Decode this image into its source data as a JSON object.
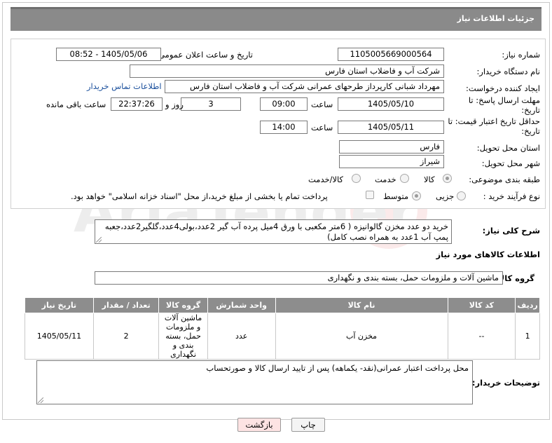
{
  "header": {
    "title": "جزئیات اطلاعات نیاز"
  },
  "form": {
    "need_number": {
      "label": "شماره نیاز:",
      "value": "1105005669000564"
    },
    "announce_datetime": {
      "label": "تاریخ و ساعت اعلان عمومی:",
      "value": "1405/05/06 - 08:52"
    },
    "buyer_org": {
      "label": "نام دستگاه خریدار:",
      "value": "شرکت آب و فاضلاب استان فارس"
    },
    "requester": {
      "label": "ایجاد کننده درخواست:",
      "value": "مهرداد شبانی کارپرداز طرحهای عمرانی  شرکت آب و فاضلاب استان فارس",
      "contact_link": "اطلاعات تماس خریدار"
    },
    "reply_deadline": {
      "label": "مهلت ارسال پاسخ: تا تاریخ:",
      "date": "1405/05/10",
      "time_label": "ساعت",
      "time": "09:00",
      "days": "3",
      "days_label": "روز و",
      "remaining": "22:37:26",
      "remaining_label": "ساعت باقی مانده"
    },
    "price_validity": {
      "label": "حداقل تاریخ اعتبار قیمت: تا تاریخ:",
      "date": "1405/05/11",
      "time_label": "ساعت",
      "time": "14:00"
    },
    "delivery_province": {
      "label": "استان محل تحویل:",
      "value": "فارس"
    },
    "delivery_city": {
      "label": "شهر محل تحویل:",
      "value": "شیراز"
    },
    "category": {
      "label": "طبقه بندی موضوعی:",
      "options": [
        "کالا",
        "خدمت",
        "کالا/خدمت"
      ],
      "selected": "کالا"
    },
    "purchase_process": {
      "label": "نوع فرآیند خرید :",
      "options": [
        "جزیی",
        "متوسط"
      ],
      "selected": "متوسط",
      "payment_note": "پرداخت تمام یا بخشی از مبلغ خرید،از محل \"اسناد خزانه اسلامی\" خواهد بود."
    }
  },
  "description": {
    "label": "شرح کلی نیاز:",
    "value": "خرید دو عدد مخزن گالوانیزه ( 6متر مکعبی با ورق 4میل پرده آب گیر 2عدد،بولی4عدد،گلگیر2عدد،جعبه پمپ آب 1عدد به همراه نصب کامل)"
  },
  "goods_info_title": "اطلاعات کالاهای مورد نیاز",
  "goods_group": {
    "label": "گروه کالا:",
    "value": "ماشین آلات و ملزومات حمل، بسته بندی و نگهداری"
  },
  "table": {
    "headers": [
      "ردیف",
      "کد کالا",
      "نام کالا",
      "واحد شمارش",
      "گروه کالا",
      "تعداد / مقدار",
      "تاریخ نیاز"
    ],
    "rows": [
      {
        "row": "1",
        "code": "--",
        "name": "مخزن آب",
        "unit": "عدد",
        "group": "ماشین آلات و ملزومات حمل، بسته بندی و نگهداری",
        "qty": "2",
        "date": "1405/05/11"
      }
    ]
  },
  "buyer_notes": {
    "label": "توضیحات خریدار:",
    "value": "محل پرداخت اعتبار عمرانی(نقد- یکماهه) پس از تایید ارسال کالا و صورتحساب"
  },
  "buttons": {
    "print": "چاپ",
    "back": "بازگشت"
  },
  "watermark_text": "AriaTender.net",
  "colors": {
    "header_bg": "#8a8a8a",
    "table_header_bg": "#8d8d8d",
    "link": "#1a4f9c",
    "back_button_bg": "#fde3e3"
  }
}
